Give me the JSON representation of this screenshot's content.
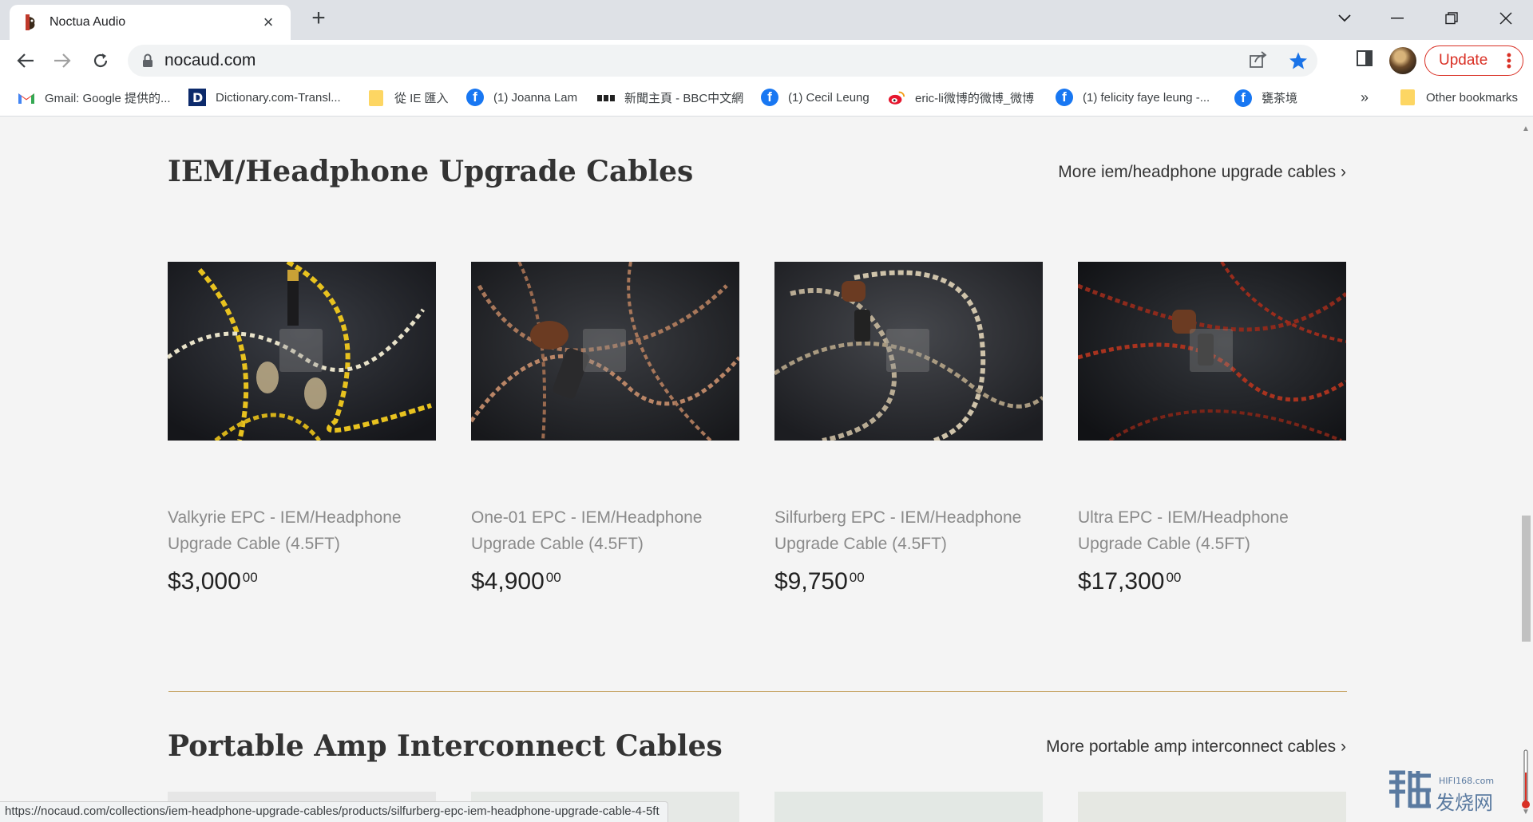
{
  "browser": {
    "tab_title": "Noctua Audio",
    "url": "nocaud.com",
    "update_label": "Update",
    "bookmarks": [
      {
        "label": "Gmail: Google 提供的...",
        "icon": "gmail-icon"
      },
      {
        "label": "Dictionary.com-Transl...",
        "icon": "dictionary-icon"
      },
      {
        "label": "從 IE 匯入",
        "icon": "folder-icon"
      },
      {
        "label": "(1) Joanna Lam",
        "icon": "facebook-icon"
      },
      {
        "label": "新聞主頁 - BBC中文網",
        "icon": "bbc-icon"
      },
      {
        "label": "(1) Cecil Leung",
        "icon": "facebook-icon"
      },
      {
        "label": "eric-li微博的微博_微博",
        "icon": "weibo-icon"
      },
      {
        "label": "(1) felicity faye leung -...",
        "icon": "facebook-icon"
      },
      {
        "label": "甕茶境",
        "icon": "facebook-icon"
      }
    ],
    "overflow_label": "»",
    "other_bookmarks": "Other bookmarks",
    "status_url": "https://nocaud.com/collections/iem-headphone-upgrade-cables/products/silfurberg-epc-iem-headphone-upgrade-cable-4-5ft"
  },
  "sections": [
    {
      "title": "IEM/Headphone Upgrade Cables",
      "more_link": "More iem/headphone upgrade cables ›",
      "products": [
        {
          "name_line1": "Valkyrie EPC - IEM/Headphone",
          "name_line2": "Upgrade Cable (4.5FT)",
          "price_main": "$3,000",
          "price_cents": "00"
        },
        {
          "name_line1": "One-01 EPC - IEM/Headphone",
          "name_line2": "Upgrade Cable (4.5FT)",
          "price_main": "$4,900",
          "price_cents": "00"
        },
        {
          "name_line1": "Silfurberg EPC - IEM/Headphone",
          "name_line2": "Upgrade Cable (4.5FT)",
          "price_main": "$9,750",
          "price_cents": "00"
        },
        {
          "name_line1": "Ultra EPC - IEM/Headphone",
          "name_line2": "Upgrade Cable (4.5FT)",
          "price_main": "$17,300",
          "price_cents": "00"
        }
      ]
    },
    {
      "title": "Portable Amp Interconnect Cables",
      "more_link": "More portable amp interconnect cables ›"
    }
  ],
  "watermark": {
    "text": "发烧网",
    "domain": "HIFI168.com"
  },
  "colors": {
    "accent_divider": "#c9a96e",
    "update_red": "#d93025",
    "star_blue": "#1a73e8"
  }
}
